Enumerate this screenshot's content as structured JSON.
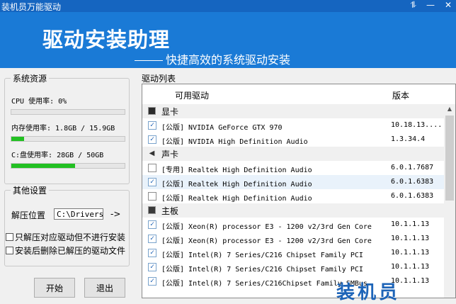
{
  "window": {
    "title": "装机员万能驱动",
    "controls": [
      "⥮",
      "—",
      "✕"
    ]
  },
  "banner": {
    "title": "驱动安装助理",
    "subtitle": "快捷高效的系统驱动安装"
  },
  "system": {
    "group_title": "系统资源",
    "cpu": {
      "label": "CPU 使用率: 0%",
      "percent": 0
    },
    "mem": {
      "label": "内存使用率: 1.8GB / 15.9GB",
      "percent": 11
    },
    "disk": {
      "label": "C:盘使用率: 28GB / 50GB",
      "percent": 56
    }
  },
  "other": {
    "group_title": "其他设置",
    "extract_label": "解压位置",
    "extract_path": "C:\\Drivers",
    "arrow": "->",
    "opt1": "只解压对应驱动但不进行安装",
    "opt2": "安装后删除已解压的驱动文件"
  },
  "buttons": {
    "start": "开始",
    "exit": "退出"
  },
  "list": {
    "label": "驱动列表",
    "col_driver": "可用驱动",
    "col_version": "版本",
    "categories": [
      {
        "name": "显卡",
        "icon": "display-icon"
      },
      {
        "name": "声卡",
        "icon": "speaker-icon"
      },
      {
        "name": "主板",
        "icon": "motherboard-icon"
      }
    ],
    "rows": [
      {
        "name": "[公版] NVIDIA GeForce GTX 970",
        "version": "10.18.13....",
        "checked": true
      },
      {
        "name": "[公版] NVIDIA High Definition Audio",
        "version": "1.3.34.4",
        "checked": true
      },
      {
        "name": "[专用] Realtek High Definition Audio",
        "version": "6.0.1.7687",
        "checked": false
      },
      {
        "name": "[公版] Realtek High Definition Audio",
        "version": "6.0.1.6383",
        "checked": true
      },
      {
        "name": "[公版] Realtek High Definition Audio",
        "version": "6.0.1.6383",
        "checked": false
      },
      {
        "name": "[公版] Xeon(R) processor E3 - 1200 v2/3rd Gen Core",
        "version": "10.1.1.13",
        "checked": true
      },
      {
        "name": "[公版] Xeon(R) processor E3 - 1200 v2/3rd Gen Core",
        "version": "10.1.1.13",
        "checked": true
      },
      {
        "name": "[公版] Intel(R) 7 Series/C216 Chipset Family PCI",
        "version": "10.1.1.13",
        "checked": true
      },
      {
        "name": "[公版] Intel(R) 7 Series/C216 Chipset Family PCI",
        "version": "10.1.1.13",
        "checked": true
      },
      {
        "name": "[公版] Intel(R) 7 Series/C216Chipset Family SMBus",
        "version": "10.1.1.13",
        "checked": true
      }
    ]
  },
  "watermark": "装机员"
}
